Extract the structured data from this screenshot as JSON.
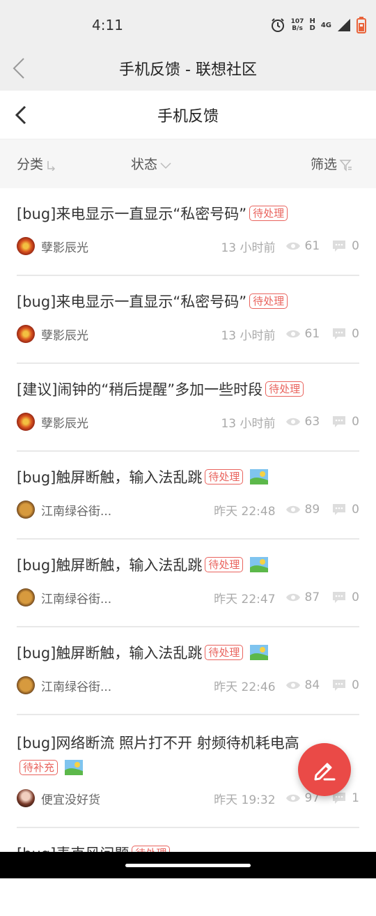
{
  "status_bar": {
    "time": "4:11",
    "net_speed_value": "107",
    "net_speed_unit": "B/s",
    "hd_top": "H",
    "hd_bottom": "D",
    "network": "4G"
  },
  "app_header": {
    "title": "手机反馈 - 联想社区"
  },
  "page_header": {
    "title": "手机反馈"
  },
  "filter_bar": {
    "category": "分类",
    "status": "状态",
    "filter": "筛选"
  },
  "posts": [
    {
      "title": "[bug]来电显示一直显示“私密号码”",
      "tag": "待处理",
      "author": "孽影辰光",
      "time": "13 小时前",
      "views": "61",
      "comments": "0"
    },
    {
      "title": "[bug]来电显示一直显示“私密号码”",
      "tag": "待处理",
      "author": "孽影辰光",
      "time": "13 小时前",
      "views": "61",
      "comments": "0"
    },
    {
      "title": "[建议]闹钟的“稍后提醒”多加一些时段",
      "tag": "待处理",
      "author": "孽影辰光",
      "time": "13 小时前",
      "views": "63",
      "comments": "0"
    },
    {
      "title": "[bug]触屏断触，输入法乱跳",
      "tag": "待处理",
      "author": "江南绿谷街...",
      "time": "昨天 22:48",
      "views": "89",
      "comments": "0"
    },
    {
      "title": "[bug]触屏断触，输入法乱跳",
      "tag": "待处理",
      "author": "江南绿谷街...",
      "time": "昨天 22:47",
      "views": "87",
      "comments": "0"
    },
    {
      "title": "[bug]触屏断触，输入法乱跳",
      "tag": "待处理",
      "author": "江南绿谷街...",
      "time": "昨天 22:46",
      "views": "84",
      "comments": "0"
    },
    {
      "title": "[bug]网络断流 照片打不开 射频待机耗电高",
      "tag": "待补充",
      "author": "便宜没好货",
      "time": "昨天 19:32",
      "views": "97",
      "comments": "1"
    },
    {
      "title": "[bug]麦克风问题",
      "tag": "待处理"
    }
  ],
  "colors": {
    "accent": "#e9635d",
    "fab": "#ea4a47"
  }
}
